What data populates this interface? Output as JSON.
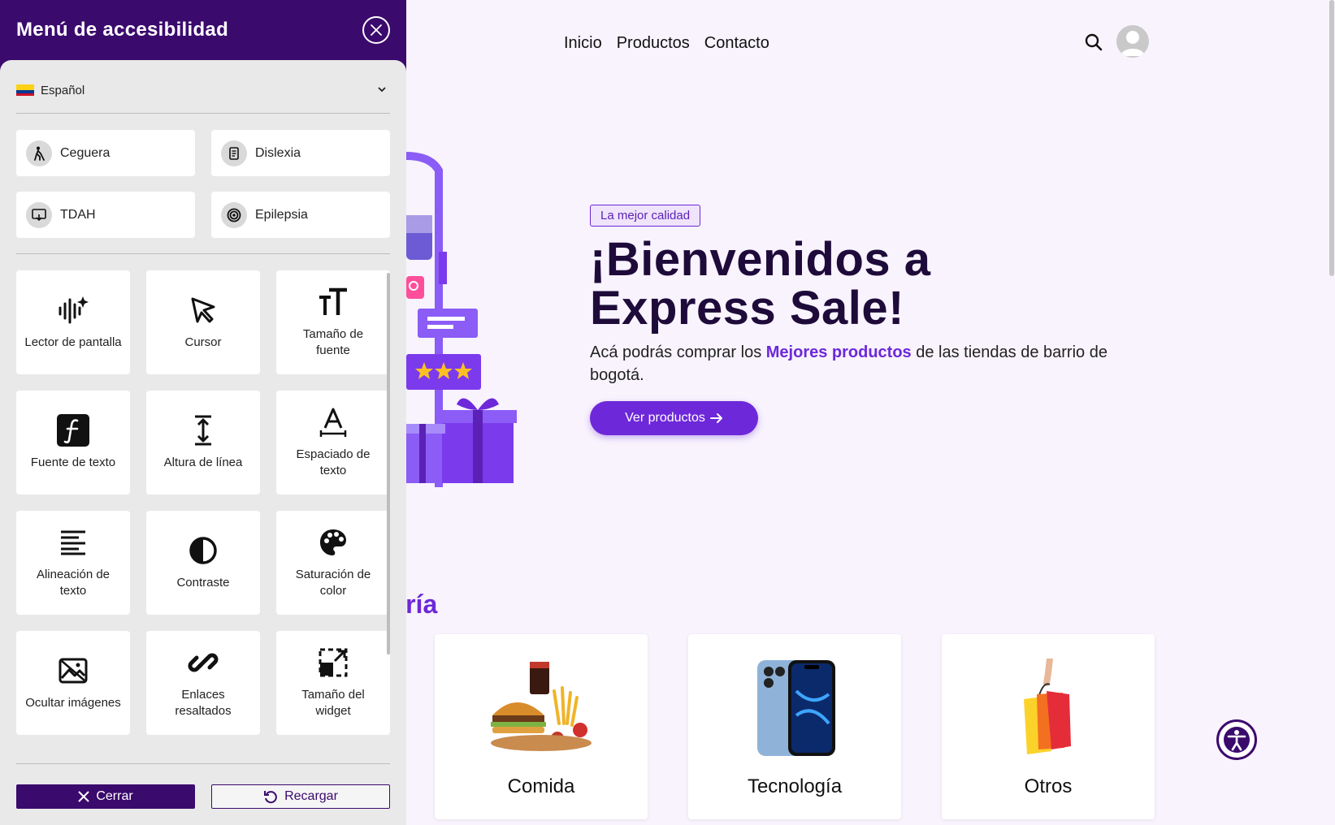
{
  "site": {
    "nav": [
      "Inicio",
      "Productos",
      "Contacto"
    ],
    "hero": {
      "badge": "La mejor calidad",
      "title_line1": "¡Bienvenidos a",
      "title_line2": "Express Sale!",
      "subtitle_pre": "Acá podrás comprar los ",
      "subtitle_highlight": "Mejores productos",
      "subtitle_post": " de las tiendas de barrio de bogotá.",
      "cta": "Ver productos"
    },
    "categories_heading": "goría",
    "categories": [
      "Comida",
      "Tecnología",
      "Otros"
    ]
  },
  "panel": {
    "title": "Menú de accesibilidad",
    "language": "Español",
    "profiles": [
      "Ceguera",
      "Dislexia",
      "TDAH",
      "Epilepsia"
    ],
    "tools": [
      {
        "label": "Lector de pantalla",
        "icon": "soundwave-sparkle-icon"
      },
      {
        "label": "Cursor",
        "icon": "cursor-icon"
      },
      {
        "label": "Tamaño de fuente",
        "icon": "font-size-icon"
      },
      {
        "label": "Fuente de texto",
        "icon": "font-family-icon"
      },
      {
        "label": "Altura de línea",
        "icon": "line-height-icon"
      },
      {
        "label": "Espaciado de texto",
        "icon": "letter-spacing-icon"
      },
      {
        "label": "Alineación de texto",
        "icon": "align-left-icon"
      },
      {
        "label": "Contraste",
        "icon": "contrast-icon"
      },
      {
        "label": "Saturación de color",
        "icon": "palette-icon"
      },
      {
        "label": "Ocultar imágenes",
        "icon": "hide-image-icon"
      },
      {
        "label": "Enlaces resaltados",
        "icon": "link-icon"
      },
      {
        "label": "Tamaño del widget",
        "icon": "resize-icon"
      }
    ],
    "close_button": "Cerrar",
    "reload_button": "Recargar"
  },
  "colors": {
    "brand_purple": "#6d28d9",
    "panel_dark": "#3b0a6d",
    "page_bg": "#f8f3fd"
  }
}
